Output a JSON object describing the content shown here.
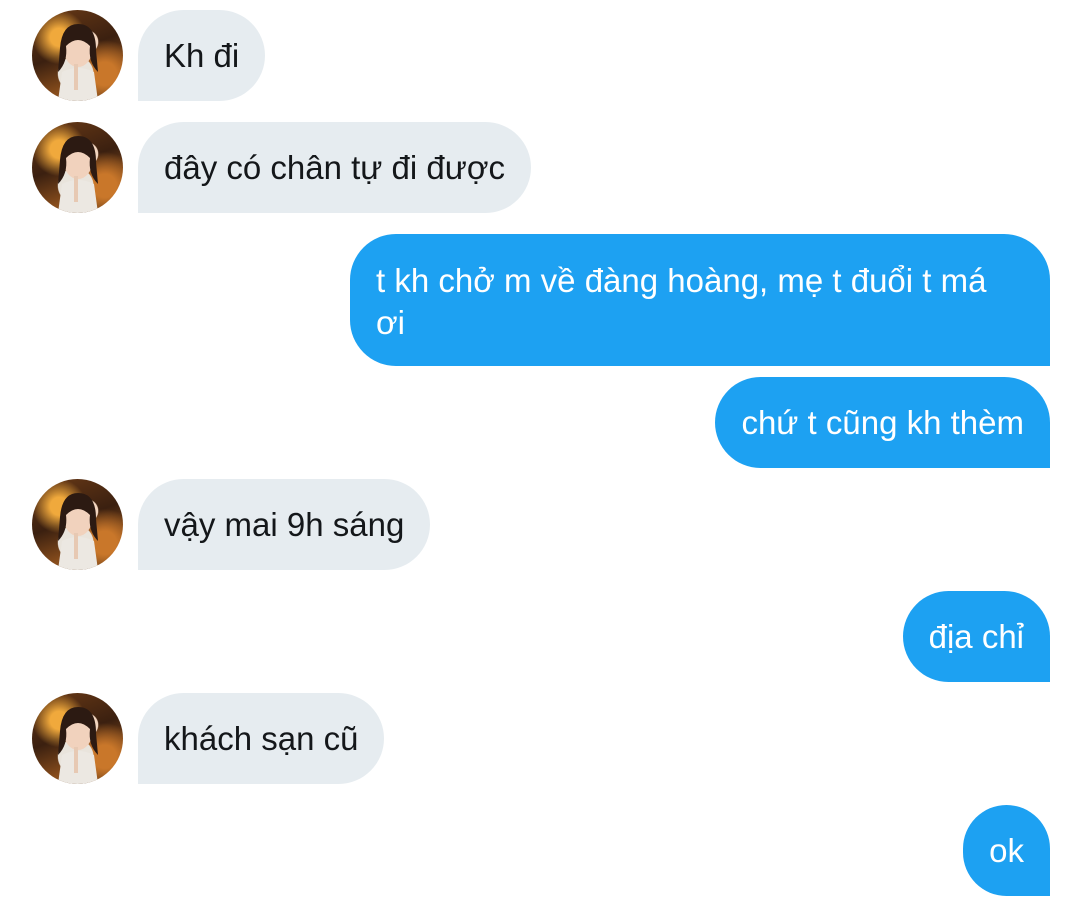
{
  "conversation": {
    "messages": [
      {
        "sender": "other",
        "text": "Kh đi"
      },
      {
        "sender": "other",
        "text": "đây có chân tự đi được"
      },
      {
        "sender": "me",
        "text": "t kh chở m về đàng hoàng, mẹ t đuổi t má ơi"
      },
      {
        "sender": "me",
        "text": "chứ t cũng kh thèm"
      },
      {
        "sender": "other",
        "text": "vậy mai 9h sáng"
      },
      {
        "sender": "me",
        "text": "địa chỉ"
      },
      {
        "sender": "other",
        "text": "khách sạn cũ"
      },
      {
        "sender": "me",
        "text": "ok"
      }
    ]
  },
  "icons": {
    "avatar": "profile-photo"
  },
  "colors": {
    "incoming_bubble": "#e6ecf0",
    "outgoing_bubble": "#1da1f2",
    "incoming_text": "#14171a",
    "outgoing_text": "#ffffff",
    "background": "#ffffff"
  }
}
